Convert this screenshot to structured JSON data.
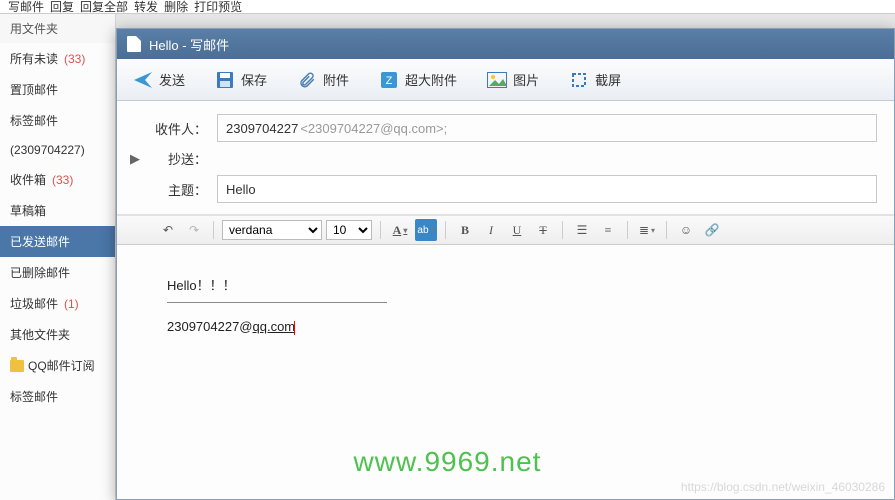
{
  "main_toolbar": {
    "items": [
      "写邮件",
      "回复",
      "回复全部",
      "转发",
      "删除",
      "打印预览"
    ]
  },
  "sidebar": {
    "header": "用文件夹",
    "items": [
      {
        "label": "所有未读",
        "count": "(33)",
        "selected": false
      },
      {
        "label": "置顶邮件",
        "count": "",
        "selected": false
      },
      {
        "label": "标签邮件",
        "count": "",
        "selected": false
      },
      {
        "label": "(2309704227)",
        "count": "",
        "selected": false
      },
      {
        "label": "收件箱",
        "count": "(33)",
        "selected": false
      },
      {
        "label": "草稿箱",
        "count": "",
        "selected": false
      },
      {
        "label": "已发送邮件",
        "count": "",
        "selected": true
      },
      {
        "label": "已删除邮件",
        "count": "",
        "selected": false
      },
      {
        "label": "垃圾邮件",
        "count": "(1)",
        "selected": false
      },
      {
        "label": "其他文件夹",
        "count": "",
        "selected": false
      },
      {
        "label": "QQ邮件订阅",
        "count": "",
        "selected": false,
        "folder": true
      },
      {
        "label": "标签邮件",
        "count": "",
        "selected": false
      }
    ]
  },
  "window": {
    "title": "Hello - 写邮件"
  },
  "compose_toolbar": {
    "send": "发送",
    "save": "保存",
    "attach": "附件",
    "big_attach": "超大附件",
    "image": "图片",
    "screenshot": "截屏"
  },
  "fields": {
    "to_label": "收件人：",
    "to_value_name": "2309704227",
    "to_value_dim": "<2309704227@qq.com>;",
    "cc_label": "抄送：",
    "subject_label": "主题：",
    "subject_value": "Hello"
  },
  "editor_toolbar": {
    "font": "verdana",
    "size": "10"
  },
  "editor_body": {
    "line1": "Hello！！！",
    "line2_a": "2309704227@",
    "line2_b": "qq.com"
  },
  "watermark1": "www.9969.net",
  "watermark2": "https://blog.csdn.net/weixin_46030286"
}
